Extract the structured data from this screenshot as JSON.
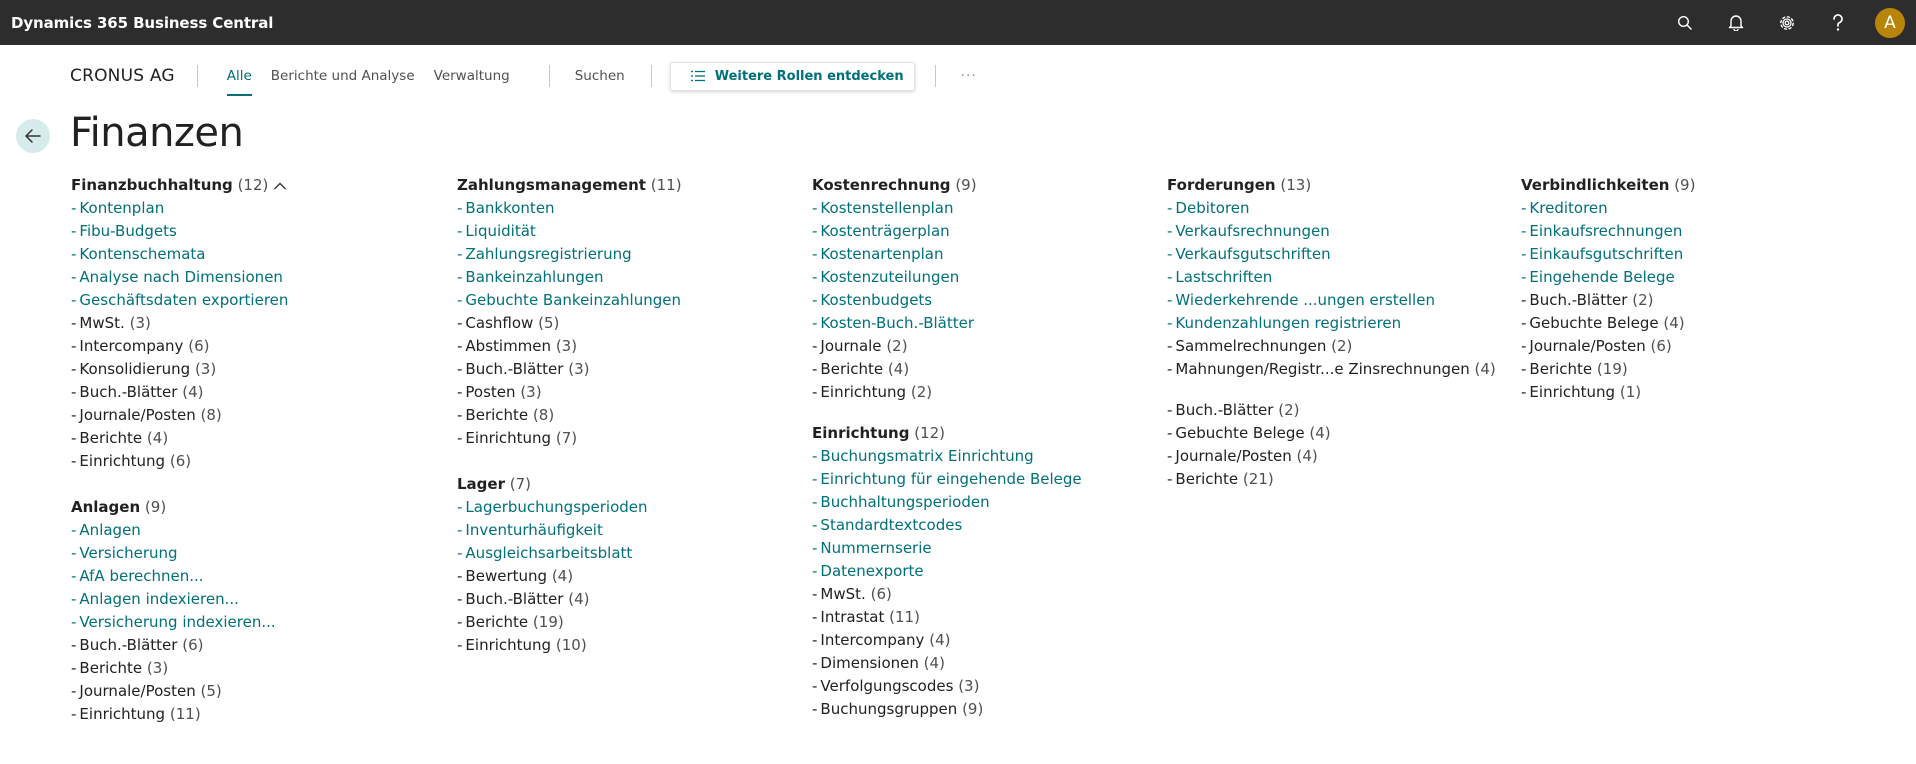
{
  "app_title": "Dynamics 365 Business Central",
  "avatar_initial": "A",
  "nav": {
    "company": "CRONUS AG",
    "tabs": [
      {
        "label": "Alle",
        "active": true
      },
      {
        "label": "Berichte und Analyse",
        "active": false
      },
      {
        "label": "Verwaltung",
        "active": false
      }
    ],
    "search_label": "Suchen",
    "discover_label": "Weitere Rollen entdecken",
    "more_label": "···"
  },
  "page_title": "Finanzen",
  "colors": {
    "accent": "#00707a",
    "topbar": "#2d2d2d",
    "avatar": "#b98509"
  },
  "columns": [
    [
      {
        "title": "Finanzbuchhaltung",
        "count": "(12)",
        "expanded": true,
        "items": [
          {
            "text": "Kontenplan",
            "link": true
          },
          {
            "text": "Fibu-Budgets",
            "link": true
          },
          {
            "text": "Kontenschemata",
            "link": true
          },
          {
            "text": "Analyse nach Dimensionen",
            "link": true
          },
          {
            "text": "Geschäftsdaten exportieren",
            "link": true
          },
          {
            "text": "MwSt.",
            "count": "(3)",
            "link": false
          },
          {
            "text": "Intercompany",
            "count": "(6)",
            "link": false
          },
          {
            "text": "Konsolidierung",
            "count": "(3)",
            "link": false
          },
          {
            "text": "Buch.-Blätter",
            "count": "(4)",
            "link": false
          },
          {
            "text": "Journale/Posten",
            "count": "(8)",
            "link": false
          },
          {
            "text": "Berichte",
            "count": "(4)",
            "link": false
          },
          {
            "text": "Einrichtung",
            "count": "(6)",
            "link": false
          }
        ]
      },
      {
        "title": "Anlagen",
        "count": "(9)",
        "items": [
          {
            "text": "Anlagen",
            "link": true
          },
          {
            "text": "Versicherung",
            "link": true
          },
          {
            "text": "AfA berechnen...",
            "link": true
          },
          {
            "text": "Anlagen indexieren...",
            "link": true
          },
          {
            "text": "Versicherung indexieren...",
            "link": true
          },
          {
            "text": "Buch.-Blätter",
            "count": "(6)",
            "link": false
          },
          {
            "text": "Berichte",
            "count": "(3)",
            "link": false
          },
          {
            "text": "Journale/Posten",
            "count": "(5)",
            "link": false
          },
          {
            "text": "Einrichtung",
            "count": "(11)",
            "link": false
          }
        ]
      }
    ],
    [
      {
        "title": "Zahlungsmanagement",
        "count": "(11)",
        "items": [
          {
            "text": "Bankkonten",
            "link": true
          },
          {
            "text": "Liquidität",
            "link": true
          },
          {
            "text": "Zahlungsregistrierung",
            "link": true
          },
          {
            "text": "Bankeinzahlungen",
            "link": true
          },
          {
            "text": "Gebuchte Bankeinzahlungen",
            "link": true
          },
          {
            "text": "Cashflow",
            "count": "(5)",
            "link": false
          },
          {
            "text": "Abstimmen",
            "count": "(3)",
            "link": false
          },
          {
            "text": "Buch.-Blätter",
            "count": "(3)",
            "link": false
          },
          {
            "text": "Posten",
            "count": "(3)",
            "link": false
          },
          {
            "text": "Berichte",
            "count": "(8)",
            "link": false
          },
          {
            "text": "Einrichtung",
            "count": "(7)",
            "link": false
          }
        ]
      },
      {
        "title": "Lager",
        "count": "(7)",
        "items": [
          {
            "text": "Lagerbuchungsperioden",
            "link": true
          },
          {
            "text": "Inventurhäufigkeit",
            "link": true
          },
          {
            "text": "Ausgleichsarbeitsblatt",
            "link": true
          },
          {
            "text": "Bewertung",
            "count": "(4)",
            "link": false
          },
          {
            "text": "Buch.-Blätter",
            "count": "(4)",
            "link": false
          },
          {
            "text": "Berichte",
            "count": "(19)",
            "link": false
          },
          {
            "text": "Einrichtung",
            "count": "(10)",
            "link": false
          }
        ]
      }
    ],
    [
      {
        "title": "Kostenrechnung",
        "count": "(9)",
        "items": [
          {
            "text": "Kostenstellenplan",
            "link": true
          },
          {
            "text": "Kostenträgerplan",
            "link": true
          },
          {
            "text": "Kostenartenplan",
            "link": true
          },
          {
            "text": "Kostenzuteilungen",
            "link": true
          },
          {
            "text": "Kostenbudgets",
            "link": true
          },
          {
            "text": "Kosten-Buch.-Blätter",
            "link": true
          },
          {
            "text": "Journale",
            "count": "(2)",
            "link": false
          },
          {
            "text": "Berichte",
            "count": "(4)",
            "link": false
          },
          {
            "text": "Einrichtung",
            "count": "(2)",
            "link": false
          }
        ]
      },
      {
        "title": "Einrichtung",
        "count": "(12)",
        "items": [
          {
            "text": "Buchungsmatrix Einrichtung",
            "link": true
          },
          {
            "text": "Einrichtung für eingehende Belege",
            "link": true
          },
          {
            "text": "Buchhaltungsperioden",
            "link": true
          },
          {
            "text": "Standardtextcodes",
            "link": true
          },
          {
            "text": "Nummernserie",
            "link": true
          },
          {
            "text": "Datenexporte",
            "link": true
          },
          {
            "text": "MwSt.",
            "count": "(6)",
            "link": false
          },
          {
            "text": "Intrastat",
            "count": "(11)",
            "link": false
          },
          {
            "text": "Intercompany",
            "count": "(4)",
            "link": false
          },
          {
            "text": "Dimensionen",
            "count": "(4)",
            "link": false
          },
          {
            "text": "Verfolgungscodes",
            "count": "(3)",
            "link": false
          },
          {
            "text": "Buchungsgruppen",
            "count": "(9)",
            "link": false
          }
        ]
      }
    ],
    [
      {
        "title": "Forderungen",
        "count": "(13)",
        "items": [
          {
            "text": "Debitoren",
            "link": true
          },
          {
            "text": "Verkaufsrechnungen",
            "link": true
          },
          {
            "text": "Verkaufsgutschriften",
            "link": true
          },
          {
            "text": "Lastschriften",
            "link": true
          },
          {
            "text": "Wiederkehrende ...ungen erstellen",
            "link": true
          },
          {
            "text": "Kundenzahlungen registrieren",
            "link": true
          },
          {
            "text": "Sammelrechnungen",
            "count": "(2)",
            "link": false
          },
          {
            "text": "Mahnungen/Registr...e Zinsrechnungen",
            "count": "(4)",
            "link": false
          }
        ]
      },
      {
        "title": "",
        "count": "",
        "items": [
          {
            "text": "Buch.-Blätter",
            "count": "(2)",
            "link": false
          },
          {
            "text": "Gebuchte Belege",
            "count": "(4)",
            "link": false
          },
          {
            "text": "Journale/Posten",
            "count": "(4)",
            "link": false
          },
          {
            "text": "Berichte",
            "count": "(21)",
            "link": false
          }
        ]
      }
    ],
    [
      {
        "title": "Verbindlichkeiten",
        "count": "(9)",
        "items": [
          {
            "text": "Kreditoren",
            "link": true
          },
          {
            "text": "Einkaufsrechnungen",
            "link": true
          },
          {
            "text": "Einkaufsgutschriften",
            "link": true
          },
          {
            "text": "Eingehende Belege",
            "link": true
          },
          {
            "text": "Buch.-Blätter",
            "count": "(2)",
            "link": false
          },
          {
            "text": "Gebuchte Belege",
            "count": "(4)",
            "link": false
          },
          {
            "text": "Journale/Posten",
            "count": "(6)",
            "link": false
          },
          {
            "text": "Berichte",
            "count": "(19)",
            "link": false
          },
          {
            "text": "Einrichtung",
            "count": "(1)",
            "link": false
          }
        ]
      }
    ]
  ]
}
